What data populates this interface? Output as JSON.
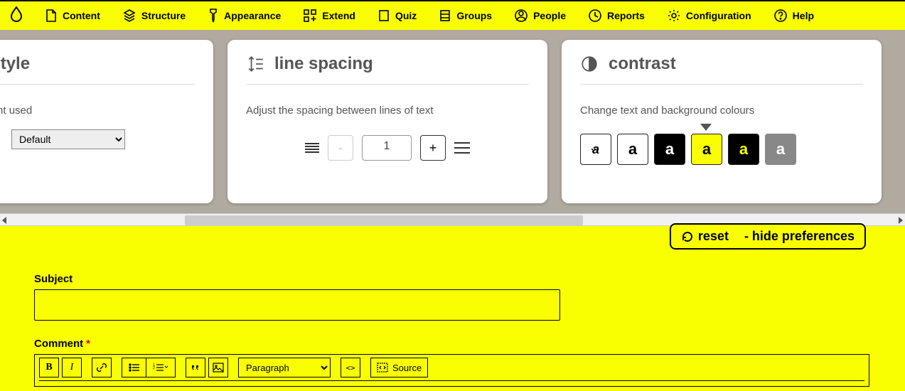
{
  "nav": {
    "items": [
      {
        "label": "Content"
      },
      {
        "label": "Structure"
      },
      {
        "label": "Appearance"
      },
      {
        "label": "Extend"
      },
      {
        "label": "Quiz"
      },
      {
        "label": "Groups"
      },
      {
        "label": "People"
      },
      {
        "label": "Reports"
      },
      {
        "label": "Configuration"
      },
      {
        "label": "Help"
      }
    ]
  },
  "cards": {
    "textstyle": {
      "title": "ext style",
      "desc": "e the font used",
      "select_value": "Default"
    },
    "linespacing": {
      "title": "line spacing",
      "desc": "Adjust the spacing between lines of text",
      "value": "1",
      "minus": "-",
      "plus": "+"
    },
    "contrast": {
      "title": "contrast",
      "desc": "Change text and background colours",
      "swatches": [
        "a",
        "a",
        "a",
        "a",
        "a",
        "a"
      ]
    }
  },
  "prefbar": {
    "reset": "reset",
    "hide": "- hide preferences"
  },
  "form": {
    "subject_label": "Subject",
    "comment_label": "Comment",
    "required": "*",
    "paragraph": "Paragraph",
    "source": "Source",
    "code": "<>",
    "bold": "B",
    "italic": "I"
  }
}
